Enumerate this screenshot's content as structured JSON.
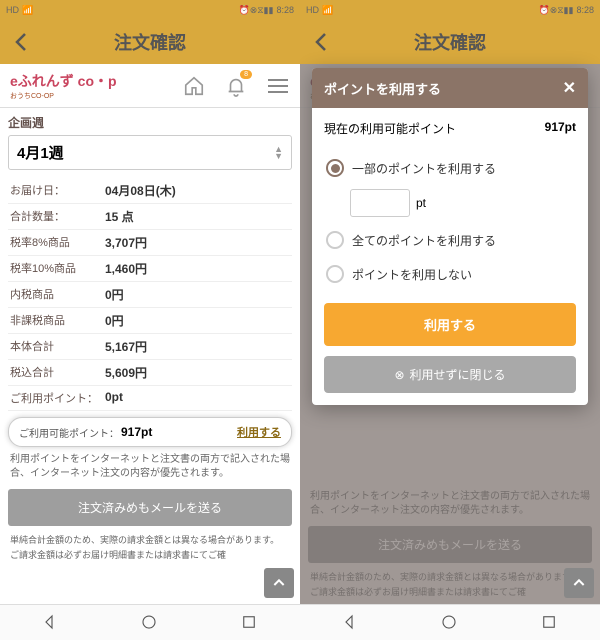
{
  "status": {
    "hd": "HD",
    "signal": "4G",
    "time": "8:28",
    "icons": "⏰⊗⧖▮▮"
  },
  "header": {
    "title": "注文確認"
  },
  "logo": {
    "main": "eふれんず co・p",
    "sub": "おうちCO-OP"
  },
  "subbar": {
    "badge": "8"
  },
  "plan": {
    "label": "企画週",
    "value": "4月1週"
  },
  "rows": [
    {
      "label": "お届け日：",
      "value": "04月08日(木)"
    },
    {
      "label": "合計数量：",
      "value": "15 点"
    },
    {
      "label": "税率8%商品",
      "value": "3,707円"
    },
    {
      "label": "税率10%商品",
      "value": "1,460円"
    },
    {
      "label": "内税商品",
      "value": "0円"
    },
    {
      "label": "非課税商品",
      "value": "0円"
    },
    {
      "label": "本体合計",
      "value": "5,167円"
    },
    {
      "label": "税込合計",
      "value": "5,609円"
    },
    {
      "label": "ご利用ポイント：",
      "value": "0pt"
    }
  ],
  "highlight": {
    "label": "ご利用可能ポイント：",
    "value": "917pt",
    "link": "利用する"
  },
  "disclaimer": "利用ポイントをインターネットと注文書の両方で記入された場合、インターネット注文の内容が優先されます。",
  "graybtn": "注文済みめもメールを送る",
  "small1": "単純合計金額のため、実際の請求金額とは異なる場合があります。",
  "small2": "ご請求金額は必ずお届け明細書または請求書にてご確",
  "modal": {
    "title": "ポイントを利用する",
    "available_label": "現在の利用可能ポイント",
    "available_value": "917pt",
    "opt1": "一部のポイントを利用する",
    "pt_suffix": "pt",
    "opt2": "全てのポイントを利用する",
    "opt3": "ポイントを利用しない",
    "submit": "利用する",
    "cancel": "利用せずに閉じる"
  }
}
